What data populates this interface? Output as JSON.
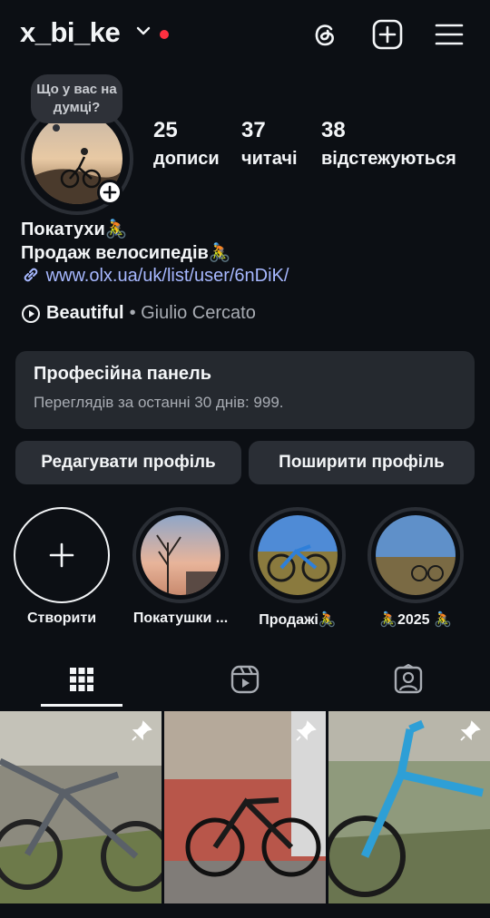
{
  "header": {
    "username": "x_bi_ke",
    "icons": [
      "chevron-down-icon",
      "threads-icon",
      "create-plus-icon",
      "menu-icon"
    ],
    "notification_color": "#ff3040"
  },
  "profile": {
    "note": "Що у вас на думці?",
    "stats": [
      {
        "value": "25",
        "label": "дописи"
      },
      {
        "value": "37",
        "label": "читачі"
      },
      {
        "value": "38",
        "label": "відстежуються"
      }
    ],
    "bio_line1": "Покатухи🚴",
    "bio_line2": "Продаж велосипедів🚴",
    "link": "www.olx.ua/uk/list/user/6nDiK/",
    "music_title": "Beautiful",
    "music_artist": "• Giulio Cercato"
  },
  "pro_panel": {
    "title": "Професійна панель",
    "subtitle": "Переглядів за останні 30 днів: 999."
  },
  "buttons": {
    "edit": "Редагувати профіль",
    "share": "Поширити профіль"
  },
  "highlights": [
    {
      "label": "Створити"
    },
    {
      "label": "Покатушки ..."
    },
    {
      "label": "Продажі🚴"
    },
    {
      "label": "🚴2025 🚴"
    }
  ],
  "tabs": [
    "grid-icon",
    "reels-icon",
    "tagged-icon"
  ],
  "colors": {
    "background": "#0c0f14",
    "surface": "#25292f",
    "link": "#a7b8ff",
    "secondary_text": "#a8acb3"
  }
}
